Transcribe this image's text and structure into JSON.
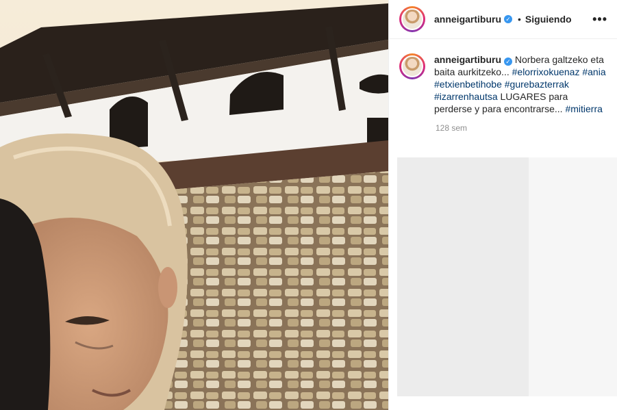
{
  "post": {
    "username": "anneigartiburu",
    "verified_mark": "✓",
    "dot": "•",
    "follow_label": "Siguiendo",
    "more_icon": "more-icon"
  },
  "caption": {
    "username": "anneigartiburu",
    "verified_mark": "✓",
    "text_1": "Norbera galtzeko eta baita aurkitzeko...",
    "tag_1": "#elorrixokuenaz",
    "tag_2": "#ania",
    "tag_3": "#etxienbetihobe",
    "tag_4": "#gurebazterrak",
    "tag_5": "#izarrenhautsa",
    "text_2": "LUGARES para perderse y para encontrarse...",
    "tag_6": "#mitierra",
    "time": "128 sem"
  },
  "colors": {
    "hashtag": "#00376b",
    "verified": "#3897f0",
    "muted": "#8e8e8e"
  }
}
